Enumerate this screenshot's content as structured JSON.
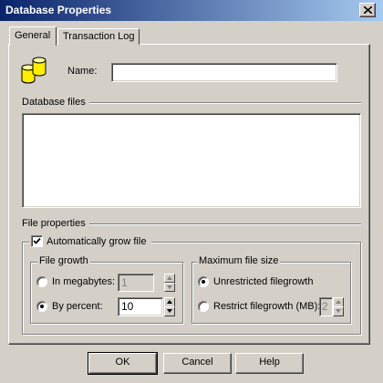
{
  "window": {
    "title": "Database Properties",
    "close_icon": "close-icon"
  },
  "tabs": [
    {
      "label": "General",
      "active": true
    },
    {
      "label": "Transaction Log",
      "active": false
    }
  ],
  "general": {
    "name_label": "Name:",
    "name_value": "",
    "database_icon": "database-icon",
    "database_files_label": "Database files",
    "file_properties_label": "File properties",
    "auto_grow_label": "Automatically grow file",
    "auto_grow_checked": true,
    "file_growth": {
      "legend": "File growth",
      "in_megabytes_label": "In megabytes:",
      "in_megabytes_value": "1",
      "by_percent_label": "By percent:",
      "by_percent_value": "10",
      "selected": "by_percent"
    },
    "max_file_size": {
      "legend": "Maximum file size",
      "unrestricted_label": "Unrestricted filegrowth",
      "restrict_label": "Restrict filegrowth (MB):",
      "restrict_value": "2",
      "selected": "unrestricted"
    }
  },
  "buttons": {
    "ok": "OK",
    "cancel": "Cancel",
    "help": "Help"
  },
  "colors": {
    "titlebar_start": "#0a246a",
    "titlebar_end": "#a6caf0",
    "face": "#d4d0c8",
    "database_icon": "#ffee00"
  }
}
